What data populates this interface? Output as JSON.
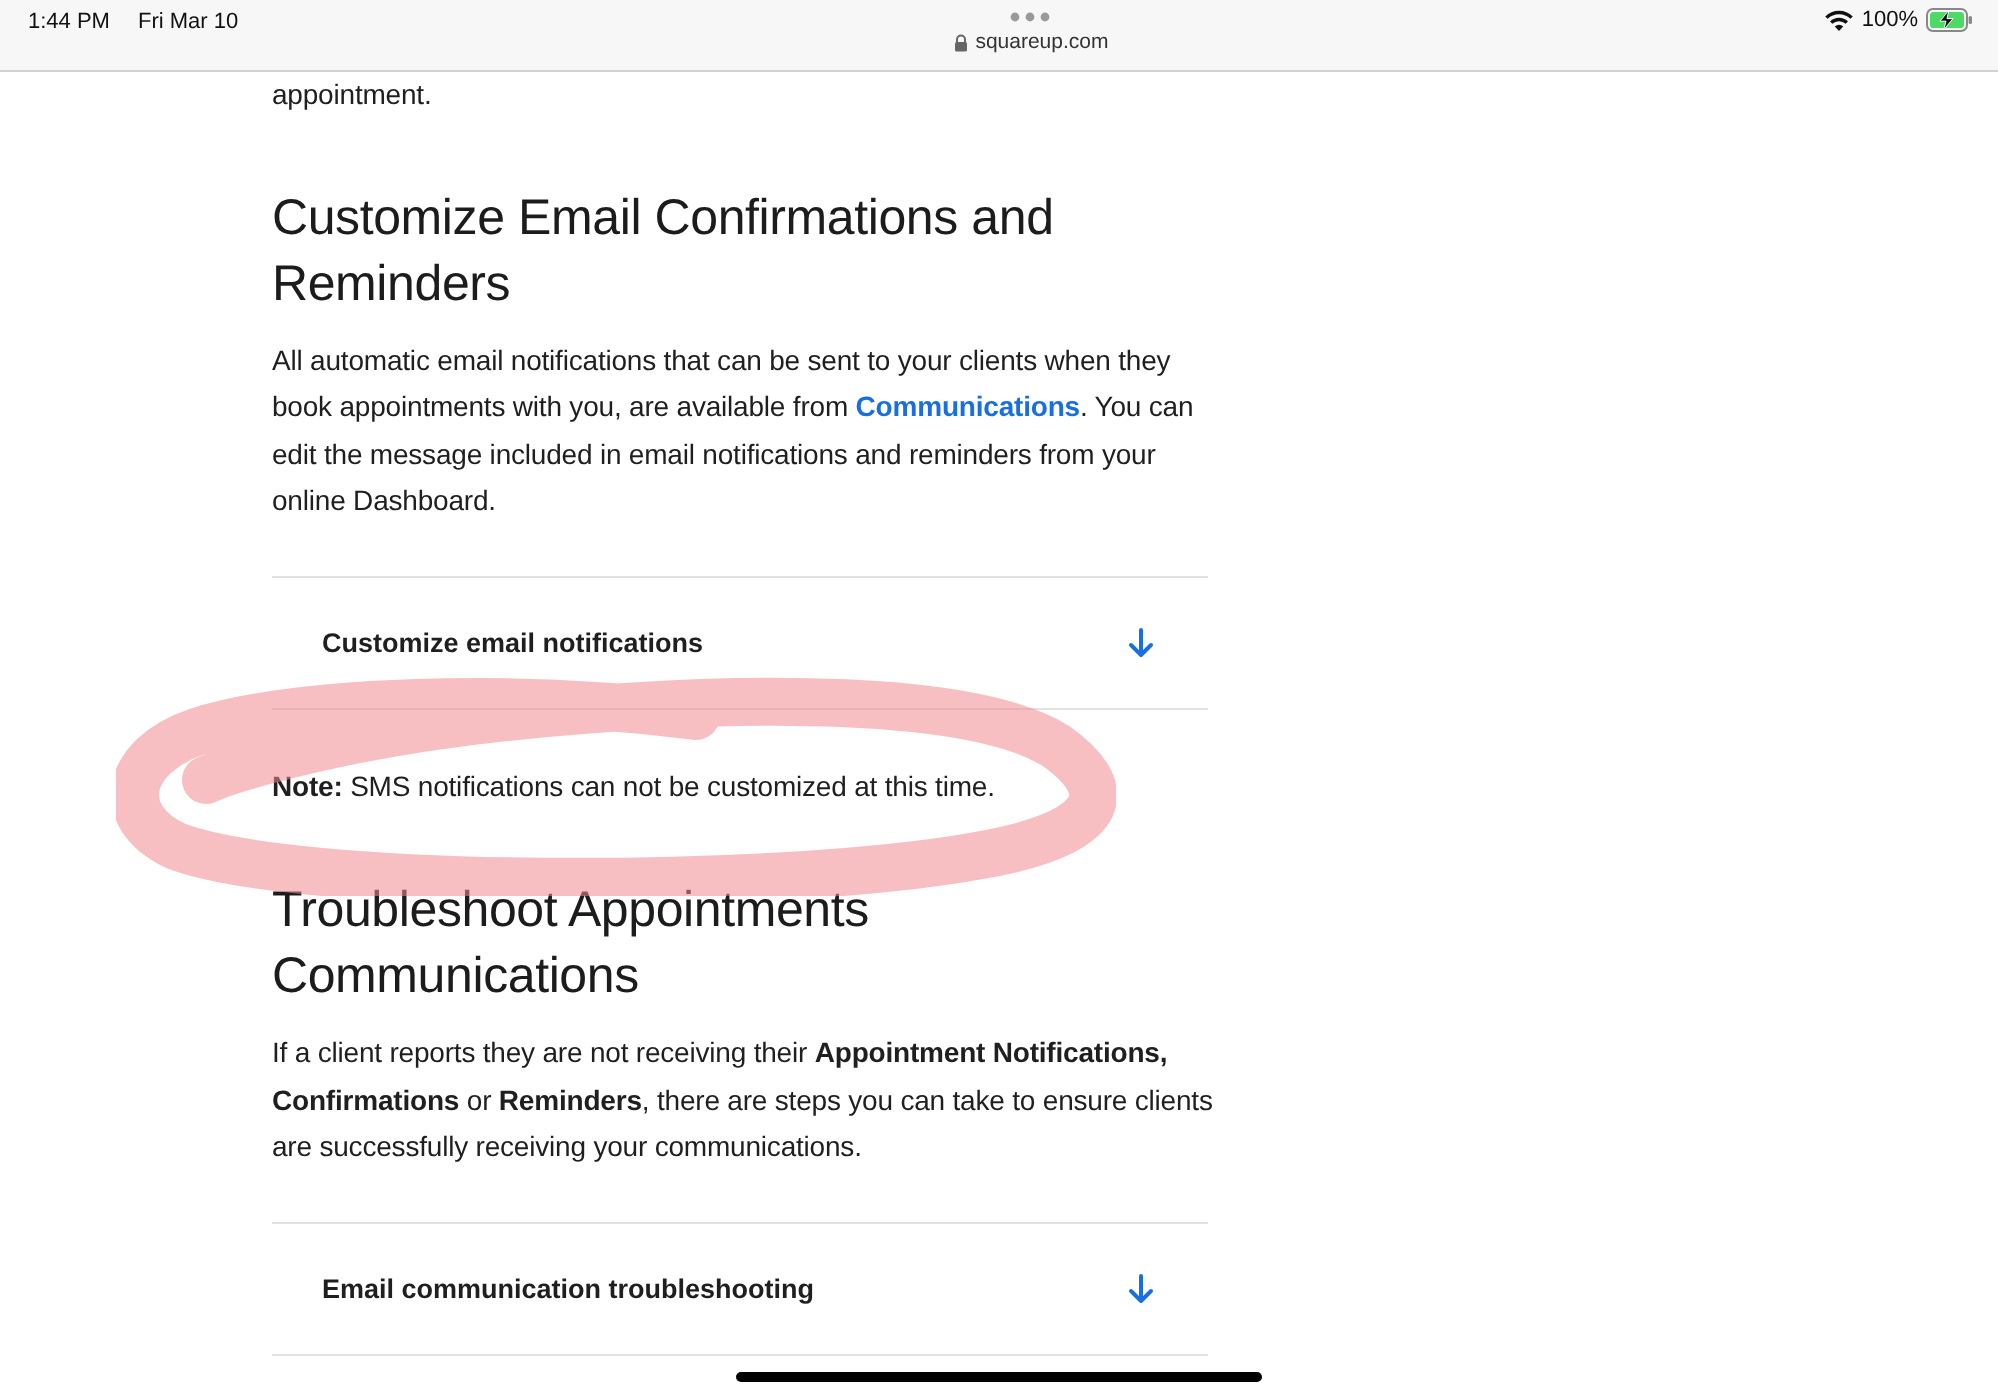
{
  "status_bar": {
    "time": "1:44 PM",
    "date": "Fri Mar 10",
    "url": "squareup.com",
    "battery": "100%",
    "charging": true
  },
  "content": [
    {
      "kind": "paragraph",
      "parts": [
        {
          "kind": "plain",
          "text": "appointment."
        }
      ]
    },
    {
      "kind": "heading",
      "text": "Customize Email Confirmations and Reminders"
    },
    {
      "kind": "paragraph",
      "parts": [
        {
          "kind": "plain",
          "text": "All automatic email notifications that can be sent to your clients when they book appointments with you, are available from "
        },
        {
          "kind": "link",
          "text": "Communications"
        },
        {
          "kind": "plain",
          "text": ". You can edit the message included in email notifications and reminders from your online Dashboard."
        }
      ]
    },
    {
      "kind": "accordion",
      "text": "Customize email notifications",
      "expanded": false
    },
    {
      "kind": "note",
      "parts": [
        {
          "kind": "bold",
          "text": "Note:"
        },
        {
          "kind": "plain",
          "text": " SMS notifications can not be customized at this time."
        }
      ]
    },
    {
      "kind": "heading",
      "text": "Troubleshoot Appointments Communications"
    },
    {
      "kind": "paragraph",
      "parts": [
        {
          "kind": "plain",
          "text": "If a client reports they are not receiving their "
        },
        {
          "kind": "bold",
          "text": "Appointment Notifications, "
        },
        {
          "kind": "bold",
          "text": "Confirmations"
        },
        {
          "kind": "plain",
          "text": " or "
        },
        {
          "kind": "bold",
          "text": "Reminders"
        },
        {
          "kind": "plain",
          "text": ", there are steps you can take to ensure clients are successfully receiving your communications."
        }
      ]
    },
    {
      "kind": "accordion",
      "text": "Email communication troubleshooting",
      "expanded": false
    }
  ]
}
